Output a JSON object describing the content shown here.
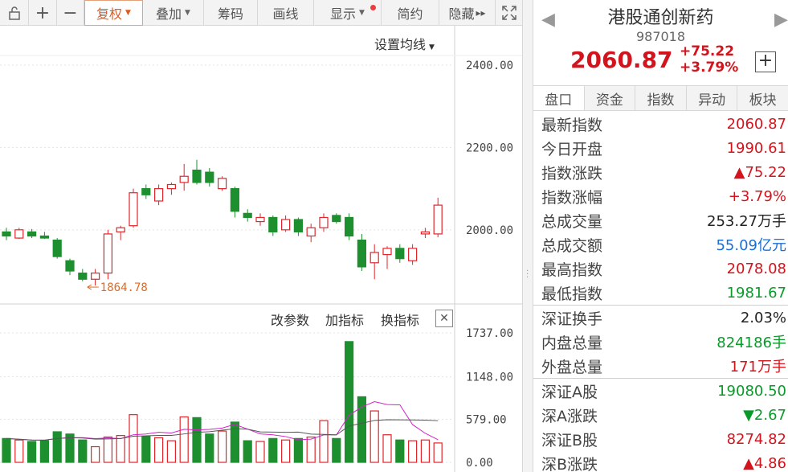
{
  "toolbar": {
    "buttons": [
      "复权",
      "叠加",
      "筹码",
      "画线",
      "显示",
      "简约",
      "隐藏"
    ],
    "hide_suffix": "▸▸"
  },
  "chart": {
    "ma_setting": "设置均线",
    "price_axis": [
      "2400.00",
      "2200.00",
      "2000.00"
    ],
    "low_marker": "1864.78",
    "volume_tools": [
      "改参数",
      "加指标",
      "换指标"
    ],
    "volume_axis": [
      "1737.00",
      "1148.00",
      "579.00",
      "0.00"
    ]
  },
  "chart_data": {
    "type": "candlestick",
    "price_ylim": [
      1820,
      2480
    ],
    "volume_ylim": [
      0,
      1737
    ],
    "candles": [
      {
        "o": 1995,
        "h": 2005,
        "l": 1975,
        "c": 1985
      },
      {
        "o": 1980,
        "h": 2005,
        "l": 1978,
        "c": 2000
      },
      {
        "o": 1995,
        "h": 2002,
        "l": 1980,
        "c": 1985
      },
      {
        "o": 1985,
        "h": 1995,
        "l": 1978,
        "c": 1980
      },
      {
        "o": 1975,
        "h": 1980,
        "l": 1930,
        "c": 1935
      },
      {
        "o": 1925,
        "h": 1930,
        "l": 1890,
        "c": 1900
      },
      {
        "o": 1895,
        "h": 1905,
        "l": 1875,
        "c": 1880
      },
      {
        "o": 1880,
        "h": 1905,
        "l": 1865,
        "c": 1895
      },
      {
        "o": 1895,
        "h": 2000,
        "l": 1880,
        "c": 1990
      },
      {
        "o": 1995,
        "h": 2010,
        "l": 1975,
        "c": 2005
      },
      {
        "o": 2010,
        "h": 2100,
        "l": 2005,
        "c": 2090
      },
      {
        "o": 2100,
        "h": 2110,
        "l": 2075,
        "c": 2085
      },
      {
        "o": 2070,
        "h": 2110,
        "l": 2060,
        "c": 2100
      },
      {
        "o": 2100,
        "h": 2115,
        "l": 2085,
        "c": 2110
      },
      {
        "o": 2115,
        "h": 2160,
        "l": 2095,
        "c": 2130
      },
      {
        "o": 2145,
        "h": 2170,
        "l": 2110,
        "c": 2115
      },
      {
        "o": 2140,
        "h": 2150,
        "l": 2105,
        "c": 2115
      },
      {
        "o": 2100,
        "h": 2130,
        "l": 2095,
        "c": 2125
      },
      {
        "o": 2100,
        "h": 2105,
        "l": 2030,
        "c": 2045
      },
      {
        "o": 2040,
        "h": 2050,
        "l": 2020,
        "c": 2030
      },
      {
        "o": 2020,
        "h": 2040,
        "l": 2010,
        "c": 2030
      },
      {
        "o": 2030,
        "h": 2035,
        "l": 1985,
        "c": 1995
      },
      {
        "o": 2000,
        "h": 2035,
        "l": 1995,
        "c": 2025
      },
      {
        "o": 2025,
        "h": 2030,
        "l": 1985,
        "c": 1995
      },
      {
        "o": 1985,
        "h": 2015,
        "l": 1970,
        "c": 2005
      },
      {
        "o": 2005,
        "h": 2040,
        "l": 1995,
        "c": 2030
      },
      {
        "o": 2035,
        "h": 2040,
        "l": 2015,
        "c": 2020
      },
      {
        "o": 2030,
        "h": 2040,
        "l": 1975,
        "c": 1985
      },
      {
        "o": 1975,
        "h": 1990,
        "l": 1900,
        "c": 1910
      },
      {
        "o": 1920,
        "h": 1965,
        "l": 1880,
        "c": 1945
      },
      {
        "o": 1940,
        "h": 1960,
        "l": 1905,
        "c": 1955
      },
      {
        "o": 1955,
        "h": 1965,
        "l": 1920,
        "c": 1930
      },
      {
        "o": 1925,
        "h": 1965,
        "l": 1915,
        "c": 1955
      },
      {
        "o": 1990,
        "h": 2005,
        "l": 1980,
        "c": 1995
      },
      {
        "o": 1990,
        "h": 2078,
        "l": 1982,
        "c": 2060
      }
    ],
    "volumes": [
      {
        "v": 320,
        "up": false
      },
      {
        "v": 300,
        "up": true
      },
      {
        "v": 280,
        "up": false
      },
      {
        "v": 290,
        "up": false
      },
      {
        "v": 410,
        "up": false
      },
      {
        "v": 380,
        "up": false
      },
      {
        "v": 300,
        "up": false
      },
      {
        "v": 210,
        "up": true
      },
      {
        "v": 340,
        "up": true
      },
      {
        "v": 360,
        "up": true
      },
      {
        "v": 640,
        "up": true
      },
      {
        "v": 350,
        "up": false
      },
      {
        "v": 330,
        "up": true
      },
      {
        "v": 290,
        "up": true
      },
      {
        "v": 610,
        "up": true
      },
      {
        "v": 600,
        "up": false
      },
      {
        "v": 380,
        "up": false
      },
      {
        "v": 420,
        "up": true
      },
      {
        "v": 540,
        "up": false
      },
      {
        "v": 290,
        "up": false
      },
      {
        "v": 280,
        "up": true
      },
      {
        "v": 320,
        "up": false
      },
      {
        "v": 300,
        "up": true
      },
      {
        "v": 320,
        "up": false
      },
      {
        "v": 340,
        "up": true
      },
      {
        "v": 560,
        "up": true
      },
      {
        "v": 320,
        "up": false
      },
      {
        "v": 1620,
        "up": false
      },
      {
        "v": 880,
        "up": false
      },
      {
        "v": 690,
        "up": true
      },
      {
        "v": 370,
        "up": true
      },
      {
        "v": 300,
        "up": false
      },
      {
        "v": 290,
        "up": true
      },
      {
        "v": 300,
        "up": true
      },
      {
        "v": 260,
        "up": true
      }
    ]
  },
  "stock": {
    "name": "港股通创新药",
    "code": "987018",
    "price": "2060.87",
    "change": "+75.22",
    "change_pct": "+3.79%"
  },
  "tabs": [
    "盘口",
    "资金",
    "指数",
    "异动",
    "板块"
  ],
  "rows": [
    {
      "label": "最新指数",
      "value": "2060.87",
      "color": "red"
    },
    {
      "label": "今日开盘",
      "value": "1990.61",
      "color": "red"
    },
    {
      "label": "指数涨跌",
      "value": "▲75.22",
      "color": "red"
    },
    {
      "label": "指数涨幅",
      "value": "+3.79%",
      "color": "red"
    },
    {
      "label": "总成交量",
      "value": "253.27万手",
      "color": "black"
    },
    {
      "label": "总成交额",
      "value": "55.09亿元",
      "color": "blue"
    },
    {
      "label": "最高指数",
      "value": "2078.08",
      "color": "red"
    },
    {
      "label": "最低指数",
      "value": "1981.67",
      "color": "green"
    },
    {
      "label": "深证换手",
      "value": "2.03%",
      "color": "black"
    },
    {
      "label": "内盘总量",
      "value": "824186手",
      "color": "green"
    },
    {
      "label": "外盘总量",
      "value": "171万手",
      "color": "red"
    },
    {
      "label": "深证A股",
      "value": "19080.50",
      "color": "green"
    },
    {
      "label": "深A涨跌",
      "value": "▼2.67",
      "color": "green"
    },
    {
      "label": "深证B股",
      "value": "8274.82",
      "color": "red"
    },
    {
      "label": "深B涨跌",
      "value": "▲4.86",
      "color": "red"
    }
  ]
}
